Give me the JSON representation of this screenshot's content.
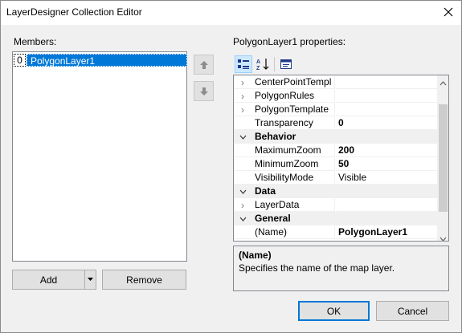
{
  "window": {
    "title": "LayerDesigner Collection Editor",
    "close_icon": "close-icon"
  },
  "members": {
    "label": "Members:",
    "items": [
      {
        "index": "0",
        "name": "PolygonLayer1",
        "selected": true
      }
    ],
    "move_up_icon": "arrow-up-icon",
    "move_down_icon": "arrow-down-icon"
  },
  "buttons": {
    "add": "Add",
    "remove": "Remove",
    "ok": "OK",
    "cancel": "Cancel"
  },
  "properties": {
    "label": "PolygonLayer1 properties:",
    "toolbar": [
      "categorized-icon",
      "alphabetical-icon",
      "property-pages-icon"
    ],
    "rows": [
      {
        "type": "prop",
        "expander": "collapsed",
        "name": "CenterPointTempl",
        "value": ""
      },
      {
        "type": "prop",
        "expander": "collapsed",
        "name": "PolygonRules",
        "value": ""
      },
      {
        "type": "prop",
        "expander": "collapsed",
        "name": "PolygonTemplate",
        "value": ""
      },
      {
        "type": "prop",
        "expander": "",
        "name": "Transparency",
        "value": "0",
        "bold": true
      },
      {
        "type": "category",
        "name": "Behavior"
      },
      {
        "type": "prop",
        "expander": "",
        "name": "MaximumZoom",
        "value": "200",
        "bold": true
      },
      {
        "type": "prop",
        "expander": "",
        "name": "MinimumZoom",
        "value": "50",
        "bold": true
      },
      {
        "type": "prop",
        "expander": "",
        "name": "VisibilityMode",
        "value": "Visible",
        "bold": false
      },
      {
        "type": "category",
        "name": "Data"
      },
      {
        "type": "prop",
        "expander": "collapsed",
        "name": "LayerData",
        "value": ""
      },
      {
        "type": "category",
        "name": "General"
      },
      {
        "type": "prop",
        "expander": "",
        "name": "(Name)",
        "value": "PolygonLayer1",
        "bold": true
      }
    ],
    "description": {
      "title": "(Name)",
      "text": "Specifies the name of the map layer."
    }
  },
  "colors": {
    "selection": "#0078d7",
    "dialog_bg": "#f0f0f0",
    "default_button_border": "#0078d7"
  }
}
